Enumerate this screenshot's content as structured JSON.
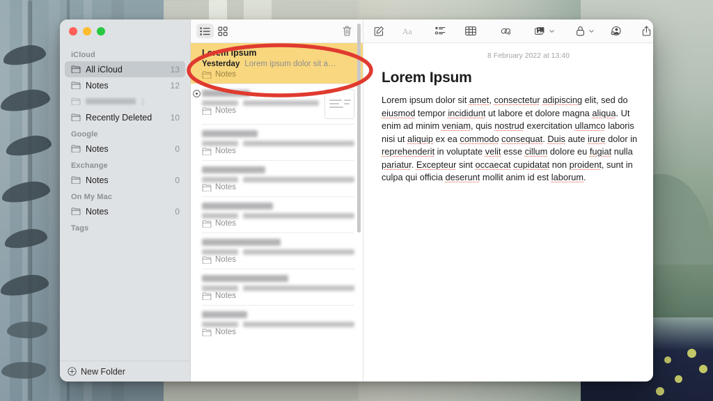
{
  "window": {
    "traffic_lights": [
      "close",
      "minimize",
      "zoom"
    ],
    "colors": {
      "close": "#ff5f57",
      "minimize": "#febc2e",
      "zoom": "#28c840",
      "selected_note": "#f8d77e",
      "annotation": "#e03a2f",
      "sidebar": "#dfe2e4"
    }
  },
  "sidebar": {
    "groups": [
      {
        "title": "iCloud",
        "items": [
          {
            "label": "All iCloud",
            "count": "13",
            "selected": true,
            "redacted": false
          },
          {
            "label": "Notes",
            "count": "12",
            "selected": false,
            "redacted": false
          },
          {
            "label": "",
            "count": "1",
            "selected": false,
            "redacted": true
          },
          {
            "label": "Recently Deleted",
            "count": "10",
            "selected": false,
            "redacted": false
          }
        ]
      },
      {
        "title": "Google",
        "items": [
          {
            "label": "Notes",
            "count": "0",
            "selected": false,
            "redacted": false
          }
        ]
      },
      {
        "title": "Exchange",
        "items": [
          {
            "label": "Notes",
            "count": "0",
            "selected": false,
            "redacted": false
          }
        ]
      },
      {
        "title": "On My Mac",
        "items": [
          {
            "label": "Notes",
            "count": "0",
            "selected": false,
            "redacted": false
          }
        ]
      },
      {
        "title": "Tags",
        "items": []
      }
    ],
    "new_folder_label": "New Folder"
  },
  "notes_list": {
    "toolbar": {
      "list_view_label": "list-view",
      "gallery_view_label": "gallery-view",
      "delete_label": "delete"
    },
    "items": [
      {
        "title": "Lorem Ipsum",
        "date": "Yesterday",
        "snippet": "Lorem ipsum dolor sit a…",
        "folder": "Notes",
        "selected": true,
        "redacted": false,
        "thumbnail": false,
        "pinned": false
      },
      {
        "title": "",
        "date": "",
        "snippet": "",
        "folder": "Notes",
        "selected": false,
        "redacted": true,
        "thumbnail": true,
        "pinned": true
      },
      {
        "title": "",
        "date": "",
        "snippet": "",
        "folder": "Notes",
        "selected": false,
        "redacted": true,
        "thumbnail": false,
        "pinned": false
      },
      {
        "title": "",
        "date": "",
        "snippet": "",
        "folder": "Notes",
        "selected": false,
        "redacted": true,
        "thumbnail": false,
        "pinned": false
      },
      {
        "title": "",
        "date": "",
        "snippet": "",
        "folder": "Notes",
        "selected": false,
        "redacted": true,
        "thumbnail": false,
        "pinned": false
      },
      {
        "title": "",
        "date": "",
        "snippet": "",
        "folder": "Notes",
        "selected": false,
        "redacted": true,
        "thumbnail": false,
        "pinned": false
      },
      {
        "title": "",
        "date": "",
        "snippet": "",
        "folder": "Notes",
        "selected": false,
        "redacted": true,
        "thumbnail": false,
        "pinned": false
      },
      {
        "title": "",
        "date": "",
        "snippet": "",
        "folder": "Notes",
        "selected": false,
        "redacted": true,
        "thumbnail": false,
        "pinned": false
      }
    ]
  },
  "editor": {
    "toolbar_items": [
      "compose-icon",
      "format-text-icon",
      "checklist-icon",
      "table-icon",
      "link-icon",
      "media-icon",
      "lock-icon",
      "collaborate-icon",
      "share-icon",
      "search-icon"
    ],
    "date": "8 February 2022 at 13:40",
    "title": "Lorem Ipsum",
    "body": "Lorem ipsum dolor sit amet, consectetur adipiscing elit, sed do eiusmod tempor incididunt ut labore et dolore magna aliqua. Ut enim ad minim veniam, quis nostrud exercitation ullamco laboris nisi ut aliquip ex ea commodo consequat. Duis aute irure dolor in reprehenderit in voluptate velit esse cillum dolore eu fugiat nulla pariatur. Excepteur sint occaecat cupidatat non proident, sunt in culpa qui officia deserunt mollit anim id est laborum."
  },
  "annotation": {
    "shape": "ellipse",
    "color": "#e03a2f",
    "target": "selected-note-row"
  }
}
